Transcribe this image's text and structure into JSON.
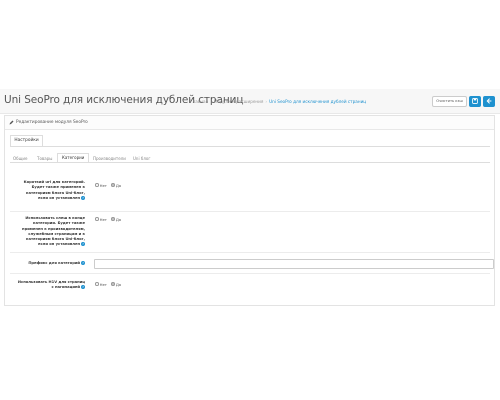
{
  "header": {
    "title": "Uni SeoPro для исключения дублей страниц",
    "breadcrumb": [
      {
        "label": "Главная",
        "active": false
      },
      {
        "label": "Модули и расширения",
        "active": false
      },
      {
        "label": "Uni SeoPro для исключения дублей страниц",
        "active": true
      }
    ],
    "clear_cache_label": "Очистить кэш",
    "save_icon": "save-icon",
    "back_icon": "back-icon",
    "accent_color": "#1e91cf"
  },
  "panel": {
    "title": "Редактирование модуля SeoPro",
    "main_tab": "Настройки",
    "subtabs": [
      {
        "label": "Общие",
        "active": false
      },
      {
        "label": "Товары",
        "active": false
      },
      {
        "label": "Категории",
        "active": true
      },
      {
        "label": "Производители",
        "active": false
      },
      {
        "label": "Uni блог",
        "active": false
      }
    ]
  },
  "form": {
    "rows": [
      {
        "label": "Короткий url для категорий. Будет также применен к категориям блога Uni-блог, если он установлен",
        "type": "radio",
        "options": [
          "Нет",
          "Да"
        ],
        "selected": "Да"
      },
      {
        "label": "Использовать слеш в конце категории. Будет также применен к производителям, служебным страницам и к категориям блога Uni-блог, если он установлен",
        "type": "radio",
        "options": [
          "Нет",
          "Да"
        ],
        "selected": "Да"
      },
      {
        "label": "Префикс для категорий",
        "type": "text",
        "value": ""
      },
      {
        "label": "Использовать H1V для страниц с пагинацией",
        "type": "radio",
        "options": [
          "Нет",
          "Да"
        ],
        "selected": "Да"
      }
    ]
  }
}
